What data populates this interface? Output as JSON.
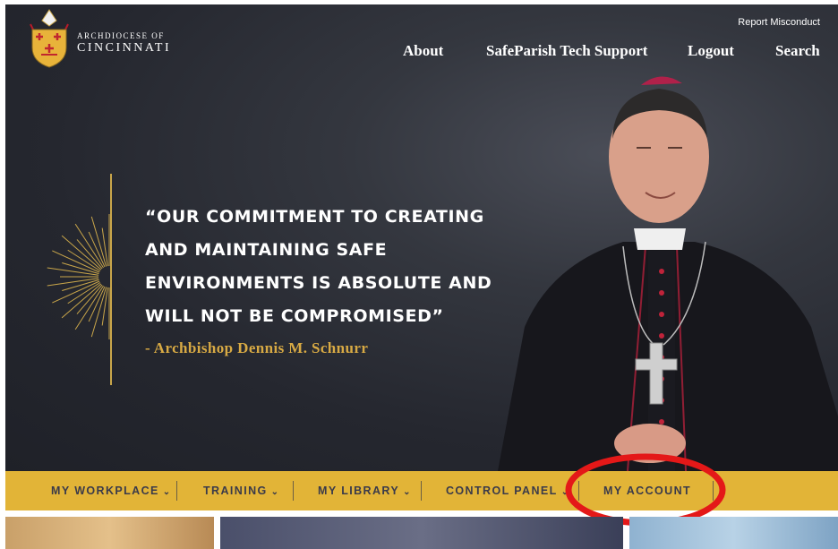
{
  "header": {
    "logo_line1": "ARCHDIOCESE OF",
    "logo_line2": "CINCINNATI",
    "report_link": "Report Misconduct",
    "nav": [
      "About",
      "SafeParish Tech Support",
      "Logout",
      "Search"
    ]
  },
  "hero": {
    "quote_line1": "“OUR COMMITMENT TO CREATING",
    "quote_line2": "AND MAINTAINING SAFE",
    "quote_line3": "ENVIRONMENTS IS ABSOLUTE AND",
    "quote_line4": "WILL NOT BE COMPROMISED”",
    "attribution": "- Archbishop Dennis M. Schnurr"
  },
  "subnav": {
    "items": [
      {
        "label": "MY WORKPLACE",
        "dropdown": true
      },
      {
        "label": "TRAINING",
        "dropdown": true
      },
      {
        "label": "MY LIBRARY",
        "dropdown": true
      },
      {
        "label": "CONTROL PANEL",
        "dropdown": true
      },
      {
        "label": "MY ACCOUNT",
        "dropdown": false
      }
    ],
    "chevron": "⌄"
  },
  "colors": {
    "hero_bg": "#25272f",
    "gold": "#e2b437",
    "accent_gold": "#d8aa44",
    "nav_text": "#3a3a4a",
    "highlight": "#e41818"
  },
  "icons": [
    "crest-icon",
    "sunburst-icon",
    "chevron-down-icon"
  ]
}
